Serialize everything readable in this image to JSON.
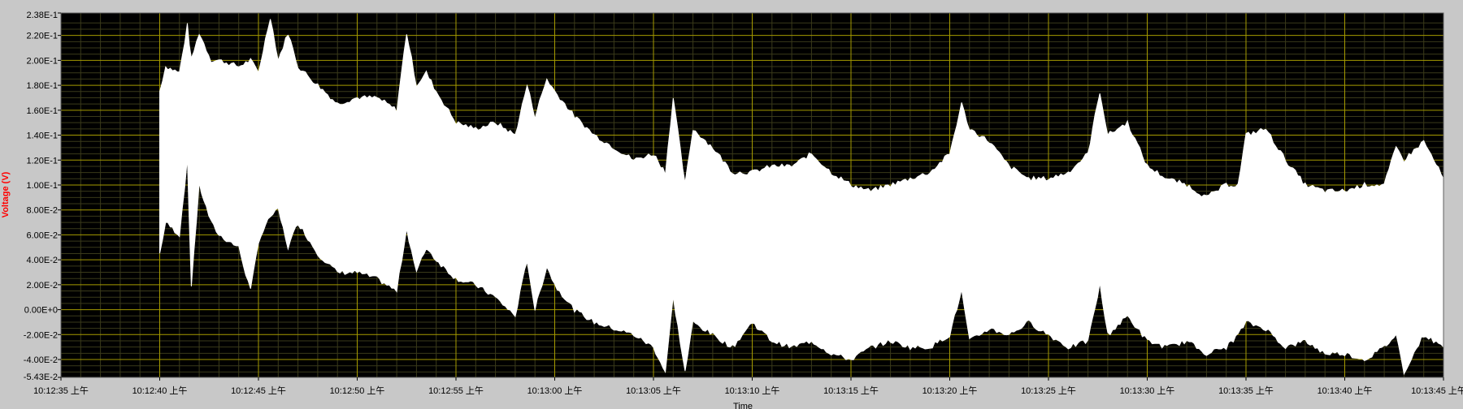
{
  "chart_data": {
    "type": "area",
    "ylabel": "Voltage (V)",
    "xlabel": "Time",
    "ylim": [
      -0.0543,
      0.238
    ],
    "xlim": [
      "10:12:35",
      "10:13:45"
    ],
    "y_ticks": [
      "2.38E-1",
      "2.20E-1",
      "2.00E-1",
      "1.80E-1",
      "1.60E-1",
      "1.40E-1",
      "1.20E-1",
      "1.00E-1",
      "8.00E-2",
      "6.00E-2",
      "4.00E-2",
      "2.00E-2",
      "0.00E+0",
      "-2.00E-2",
      "-4.00E-2",
      "-5.43E-2"
    ],
    "y_tick_values": [
      0.238,
      0.22,
      0.2,
      0.18,
      0.16,
      0.14,
      0.12,
      0.1,
      0.08,
      0.06,
      0.04,
      0.02,
      0.0,
      -0.02,
      -0.04,
      -0.0543
    ],
    "x_ticks": [
      "10:12:35 上午",
      "10:12:40 上午",
      "10:12:45 上午",
      "10:12:50 上午",
      "10:12:55 上午",
      "10:13:00 上午",
      "10:13:05 上午",
      "10:13:10 上午",
      "10:13:15 上午",
      "10:13:20 上午",
      "10:13:25 上午",
      "10:13:30 上午",
      "10:13:35 上午",
      "10:13:40 上午",
      "10:13:45 上午"
    ],
    "x_tick_values": [
      "10:12:35",
      "10:12:40",
      "10:12:45",
      "10:12:50",
      "10:12:55",
      "10:13:00",
      "10:13:05",
      "10:13:10",
      "10:13:15",
      "10:13:20",
      "10:13:25",
      "10:13:30",
      "10:13:35",
      "10:13:40",
      "10:13:45"
    ],
    "grid": true,
    "colors": {
      "plot_bg": "#000000",
      "signal": "#ffffff",
      "major_grid": "#a59a00",
      "minor_grid": "#3a3a1a",
      "ylabel": "#ff0000",
      "frame": "#c8c8c8"
    },
    "envelope": {
      "x": [
        "10:12:40",
        "10:12:40.3",
        "10:12:41",
        "10:12:41.4",
        "10:12:41.6",
        "10:12:42",
        "10:12:42.6",
        "10:12:43",
        "10:12:44",
        "10:12:44.6",
        "10:12:45",
        "10:12:45.6",
        "10:12:46",
        "10:12:46.5",
        "10:12:47",
        "10:12:48",
        "10:12:49",
        "10:12:50",
        "10:12:51",
        "10:12:52",
        "10:12:52.5",
        "10:12:53",
        "10:12:53.5",
        "10:12:54",
        "10:12:55",
        "10:12:56",
        "10:12:57",
        "10:12:58",
        "10:12:58.6",
        "10:12:59",
        "10:12:59.6",
        "10:13:00",
        "10:13:01",
        "10:13:02",
        "10:13:03",
        "10:13:04",
        "10:13:05",
        "10:13:05.6",
        "10:13:06",
        "10:13:06.6",
        "10:13:07",
        "10:13:08",
        "10:13:09",
        "10:13:10",
        "10:13:11",
        "10:13:12",
        "10:13:13",
        "10:13:14",
        "10:13:15",
        "10:13:16",
        "10:13:17",
        "10:13:18",
        "10:13:19",
        "10:13:20",
        "10:13:20.6",
        "10:13:21",
        "10:13:22",
        "10:13:23",
        "10:13:24",
        "10:13:25",
        "10:13:26",
        "10:13:27",
        "10:13:27.6",
        "10:13:28",
        "10:13:29",
        "10:13:30",
        "10:13:31",
        "10:13:32",
        "10:13:33",
        "10:13:34",
        "10:13:34.6",
        "10:13:35",
        "10:13:36",
        "10:13:37",
        "10:13:38",
        "10:13:39",
        "10:13:40",
        "10:13:41",
        "10:13:42",
        "10:13:42.6",
        "10:13:43",
        "10:13:44",
        "10:13:45"
      ],
      "upper": [
        0.175,
        0.195,
        0.19,
        0.228,
        0.2,
        0.222,
        0.2,
        0.2,
        0.195,
        0.2,
        0.19,
        0.235,
        0.2,
        0.222,
        0.195,
        0.18,
        0.165,
        0.17,
        0.17,
        0.16,
        0.222,
        0.18,
        0.19,
        0.175,
        0.15,
        0.145,
        0.15,
        0.14,
        0.18,
        0.155,
        0.185,
        0.175,
        0.155,
        0.14,
        0.13,
        0.12,
        0.125,
        0.11,
        0.17,
        0.1,
        0.145,
        0.13,
        0.11,
        0.11,
        0.115,
        0.115,
        0.125,
        0.11,
        0.1,
        0.095,
        0.1,
        0.105,
        0.11,
        0.125,
        0.165,
        0.145,
        0.135,
        0.115,
        0.105,
        0.105,
        0.11,
        0.125,
        0.175,
        0.14,
        0.15,
        0.115,
        0.105,
        0.1,
        0.09,
        0.1,
        0.1,
        0.14,
        0.145,
        0.12,
        0.1,
        0.095,
        0.095,
        0.1,
        0.1,
        0.13,
        0.12,
        0.135,
        0.105
      ],
      "lower": [
        0.045,
        0.07,
        0.06,
        0.12,
        0.02,
        0.1,
        0.07,
        0.06,
        0.05,
        0.015,
        0.055,
        0.075,
        0.08,
        0.05,
        0.07,
        0.045,
        0.03,
        0.03,
        0.025,
        0.015,
        0.065,
        0.03,
        0.05,
        0.04,
        0.025,
        0.02,
        0.01,
        -0.005,
        0.04,
        0.0,
        0.035,
        0.02,
        0.0,
        -0.01,
        -0.015,
        -0.02,
        -0.03,
        -0.05,
        0.01,
        -0.05,
        -0.01,
        -0.02,
        -0.03,
        -0.01,
        -0.025,
        -0.03,
        -0.025,
        -0.035,
        -0.04,
        -0.03,
        -0.025,
        -0.03,
        -0.03,
        -0.02,
        0.015,
        -0.025,
        -0.015,
        -0.02,
        -0.01,
        -0.02,
        -0.03,
        -0.025,
        0.02,
        -0.02,
        -0.005,
        -0.025,
        -0.03,
        -0.025,
        -0.035,
        -0.03,
        -0.02,
        -0.01,
        -0.015,
        -0.03,
        -0.025,
        -0.035,
        -0.035,
        -0.04,
        -0.03,
        -0.02,
        -0.05,
        -0.02,
        -0.03
      ]
    }
  }
}
